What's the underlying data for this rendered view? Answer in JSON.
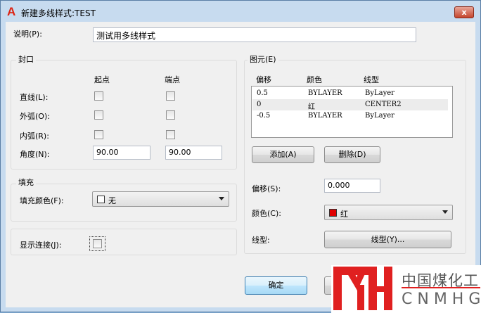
{
  "window": {
    "title": "新建多线样式:TEST",
    "close": "x"
  },
  "description": {
    "label": "说明(P):",
    "value": "测试用多线样式"
  },
  "caps": {
    "title": "封口",
    "col_start": "起点",
    "col_end": "端点",
    "rows": [
      {
        "label": "直线(L):",
        "start": false,
        "end": false
      },
      {
        "label": "外弧(O):",
        "start": false,
        "end": false
      },
      {
        "label": "内弧(R):",
        "start": false,
        "end": false
      }
    ],
    "angle_label": "角度(N):",
    "angle_start": "90.00",
    "angle_end": "90.00"
  },
  "fill": {
    "title": "填充",
    "color_label": "填充颜色(F):",
    "color_value": "无"
  },
  "joints": {
    "label": "显示连接(J):",
    "checked": false
  },
  "elements": {
    "title": "图元(E)",
    "headers": [
      "偏移",
      "颜色",
      "线型"
    ],
    "rows": [
      {
        "offset": "0.5",
        "color": "BYLAYER",
        "linetype": "ByLayer"
      },
      {
        "offset": "0",
        "color": "红",
        "linetype": "CENTER2"
      },
      {
        "offset": "-0.5",
        "color": "BYLAYER",
        "linetype": "ByLayer"
      }
    ],
    "add": "添加(A)",
    "delete": "删除(D)",
    "offset_label": "偏移(S):",
    "offset_value": "0.000",
    "color_label": "颜色(C):",
    "color_value": "红",
    "color_swatch": "#e00000",
    "linetype_label": "线型:",
    "linetype_button": "线型(Y)..."
  },
  "footer": {
    "ok": "确定"
  },
  "watermark": {
    "cn": "中国煤化工",
    "en": "CNMHG",
    "color": "#e02020"
  }
}
